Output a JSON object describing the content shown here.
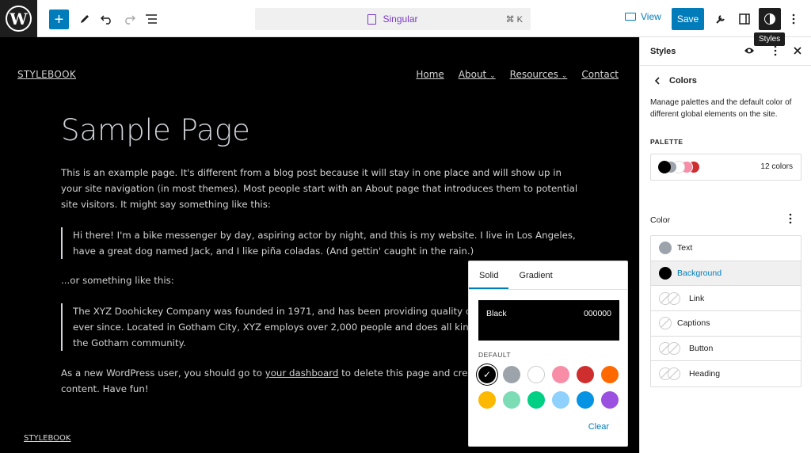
{
  "toolbar": {
    "add_symbol": "+",
    "document_title": "Singular",
    "shortcut": "⌘ K",
    "view_label": "View",
    "save_label": "Save",
    "tooltip": "Styles"
  },
  "canvas": {
    "site_title": "STYLEBOOK",
    "nav": [
      "Home",
      "About",
      "Resources",
      "Contact"
    ],
    "page_title": "Sample Page",
    "p1": "This is an example page. It's different from a blog post because it will stay in one place and will show up in your site navigation (in most themes). Most people start with an About page that introduces them to potential site visitors. It might say something like this:",
    "quote1": "Hi there! I'm a bike messenger by day, aspiring actor by night, and this is my website. I live in Los Angeles, have a great dog named Jack, and I like piña coladas. (And gettin' caught in the rain.)",
    "p2": "...or something like this:",
    "quote2_visible": "The XYZ Doohickey Company was founded in 1971, and has been providing quality doohi",
    "quote2_line2": "ever since. Located in Gotham City, XYZ employs over 2,000 people and does all kinds o",
    "quote2_line3": "the Gotham community.",
    "p3_start": "As a new WordPress user, you should go to ",
    "p3_link": "your dashboard",
    "p3_end": " to delete this page and create",
    "p3_line2": "content. Have fun!",
    "footer_title": "STYLEBOOK"
  },
  "popover": {
    "tabs": [
      "Solid",
      "Gradient"
    ],
    "selected_name": "Black",
    "selected_hex": "000000",
    "default_label": "DEFAULT",
    "clear_label": "Clear",
    "swatches": [
      "#000000",
      "#9ca3ab",
      "#ffffff",
      "#f78da7",
      "#cf2e2e",
      "#ff6900",
      "#fcb900",
      "#7bdcb5",
      "#00d084",
      "#8ed1fc",
      "#0693e3",
      "#9b51e0"
    ]
  },
  "sidebar": {
    "title": "Styles",
    "section_title": "Colors",
    "description": "Manage palettes and the default color of different global elements on the site.",
    "palette_label": "PALETTE",
    "palette_count": "12 colors",
    "palette_preview": [
      "#000000",
      "#9ca3ab",
      "#ffffff",
      "#f78da7",
      "#cf2e2e"
    ],
    "color_label": "Color",
    "elements": [
      {
        "label": "Text",
        "color": "#9ca3ab"
      },
      {
        "label": "Background",
        "color": "#000000"
      },
      {
        "label": "Link",
        "color": ""
      },
      {
        "label": "Captions",
        "color": ""
      },
      {
        "label": "Button",
        "color": ""
      },
      {
        "label": "Heading",
        "color": ""
      }
    ]
  },
  "colors": {
    "accent": "#007cba",
    "doc_accent": "#7a3bc4"
  }
}
